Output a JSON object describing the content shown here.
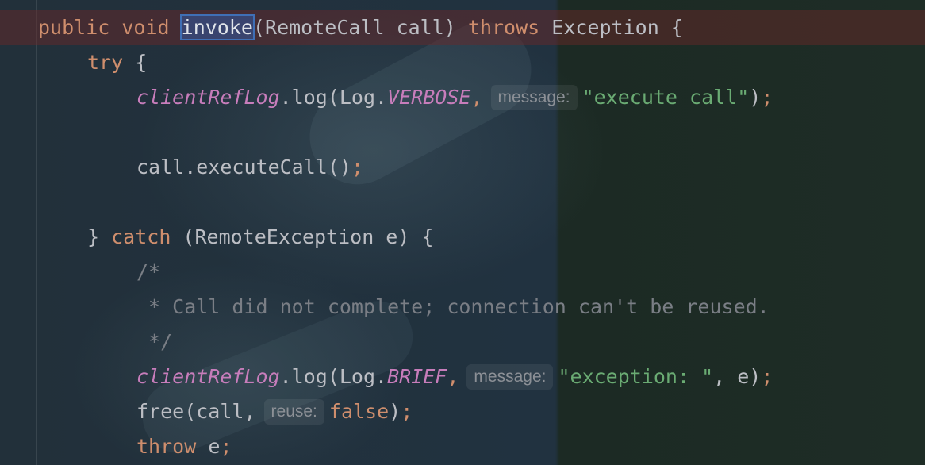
{
  "editor": {
    "lines": [
      {
        "id": "l1",
        "tokens": {
          "kw_public": "public",
          "kw_void": "void",
          "method": "invoke",
          "params": "(RemoteCall call)",
          "kw_throws": "throws",
          "exc": "Exception {"
        }
      },
      {
        "id": "l2",
        "tokens": {
          "kw_try": "try",
          "brace": " {"
        }
      },
      {
        "id": "l3",
        "tokens": {
          "field": "clientRefLog",
          "call": ".log(Log.",
          "const": "VERBOSE",
          "comma": ",",
          "hint": "message:",
          "str": "\"execute call\"",
          "tail": ")",
          "semi": ";"
        }
      },
      {
        "id": "l4",
        "tokens": {
          "text": "call.executeCall()",
          "semi": ";"
        }
      },
      {
        "id": "l5",
        "tokens": {
          "close": "} ",
          "kw_catch": "catch",
          "rest": " (RemoteException e) {"
        }
      },
      {
        "id": "l6",
        "tokens": {
          "cmt": "/*"
        }
      },
      {
        "id": "l7",
        "tokens": {
          "cmt": " * Call did not complete; connection can't be reused."
        }
      },
      {
        "id": "l8",
        "tokens": {
          "cmt": " */"
        }
      },
      {
        "id": "l9",
        "tokens": {
          "field": "clientRefLog",
          "call": ".log(Log.",
          "const": "BRIEF",
          "comma": ",",
          "hint": "message:",
          "str": "\"exception: \"",
          "rest": ", e)",
          "semi": ";"
        }
      },
      {
        "id": "l10",
        "tokens": {
          "call": "free(call,",
          "hint": "reuse:",
          "kw_false": "false",
          "tail": ")",
          "semi": ";"
        }
      },
      {
        "id": "l11",
        "tokens": {
          "kw_throw": "throw",
          "rest": " e",
          "semi": ";"
        }
      }
    ]
  },
  "colors": {
    "keyword": "#cf8e6d",
    "field": "#c77dbb",
    "string": "#6aab73",
    "comment": "#7a7e85",
    "text": "#bcbec4",
    "current_line": "#6e2828",
    "selection": "#3f6fb5"
  }
}
